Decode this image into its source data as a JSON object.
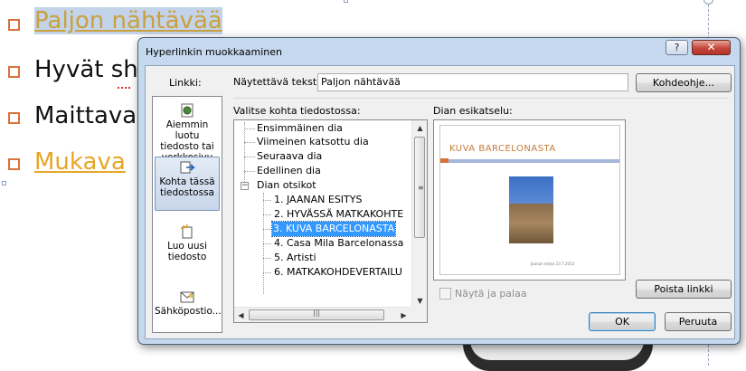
{
  "slide": {
    "bullets": [
      "Paljon nähtävää",
      "Hyvät sh",
      "Maittava",
      "Mukava "
    ]
  },
  "dialog": {
    "title": "Hyperlinkin muokkaaminen",
    "help_label": "?",
    "close_label": "✕",
    "link_to_label": "Linkki:",
    "sidebar": [
      {
        "id": "existing",
        "label": "Aiemmin luotu tiedosto tai verkkosivu",
        "icon": "web-page-icon",
        "selected": false
      },
      {
        "id": "place",
        "label": "Kohta tässä tiedostossa",
        "icon": "document-place-icon",
        "selected": true
      },
      {
        "id": "new",
        "label": "Luo uusi tiedosto",
        "icon": "new-document-icon",
        "selected": false
      },
      {
        "id": "email",
        "label": "Sähköpostio...",
        "icon": "email-icon",
        "selected": false
      }
    ],
    "display_text_label": "Näytettävä teksti:",
    "display_text_value": "Paljon nähtävää",
    "screentip_label": "Kohdeohje...",
    "place_label": "Valitse kohta tiedostossa:",
    "preview_label": "Dian esikatselu:",
    "tree": [
      {
        "label": "Ensimmäinen dia",
        "level": 1
      },
      {
        "label": "Viimeinen katsottu dia",
        "level": 1
      },
      {
        "label": "Seuraava dia",
        "level": 1
      },
      {
        "label": "Edellinen dia",
        "level": 1
      },
      {
        "label": "Dian otsikot",
        "level": 1,
        "expander": "−"
      },
      {
        "label": "1. JAANAN ESITYS",
        "level": 2
      },
      {
        "label": "2. HYVÄSSÄ MATKAKOHTE",
        "level": 2
      },
      {
        "label": "3. KUVA BARCELONASTA",
        "level": 2,
        "selected": true
      },
      {
        "label": "4. Casa Mila Barcelonassa",
        "level": 2
      },
      {
        "label": "5. Artisti",
        "level": 2
      },
      {
        "label": "6. MATKAKOHDEVERTAILU",
        "level": 2
      }
    ],
    "preview": {
      "slide_title": "KUVA BARCELONASTA",
      "footer": "Jaanan esitys   23.7.2013"
    },
    "show_and_return_label": "Näytä ja palaa",
    "remove_link_label": "Poista linkki",
    "ok_label": "OK",
    "cancel_label": "Peruuta"
  }
}
